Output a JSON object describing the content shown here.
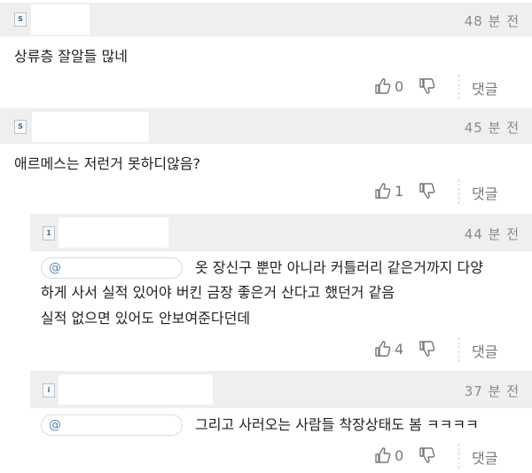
{
  "comments": [
    {
      "time": "48 분 전",
      "text": "상류층 잘알들 많네",
      "likes": "0",
      "reply_label": "댓글"
    },
    {
      "time": "45 분 전",
      "text": "애르메스는 저런거 못하디않음?",
      "likes": "1",
      "reply_label": "댓글"
    },
    {
      "time": "44 분 전",
      "mention_symbol": "@",
      "line1": "옷 장신구 뿐만 아니라 커틀러리 같은거까지 다양",
      "line2": "하게 사서 실적 있어야 버킨 금장 좋은거 산다고 했던거 같음",
      "line3": "실적 없으면 있어도 안보여준다던데",
      "likes": "4",
      "reply_label": "댓글"
    },
    {
      "time": "37 분 전",
      "mention_symbol": "@",
      "text": "그리고 사러오는 사람들 착장상태도 봄 ㅋㅋㅋㅋ",
      "likes": "0",
      "reply_label": "댓글"
    }
  ],
  "icons": {
    "like": "thumbs-up-icon",
    "dislike": "thumbs-down-icon",
    "avatar": "profile-icon"
  },
  "colors": {
    "header_bg": "#efefef",
    "time": "#8a8a8a",
    "mention": "#5a87b0"
  }
}
